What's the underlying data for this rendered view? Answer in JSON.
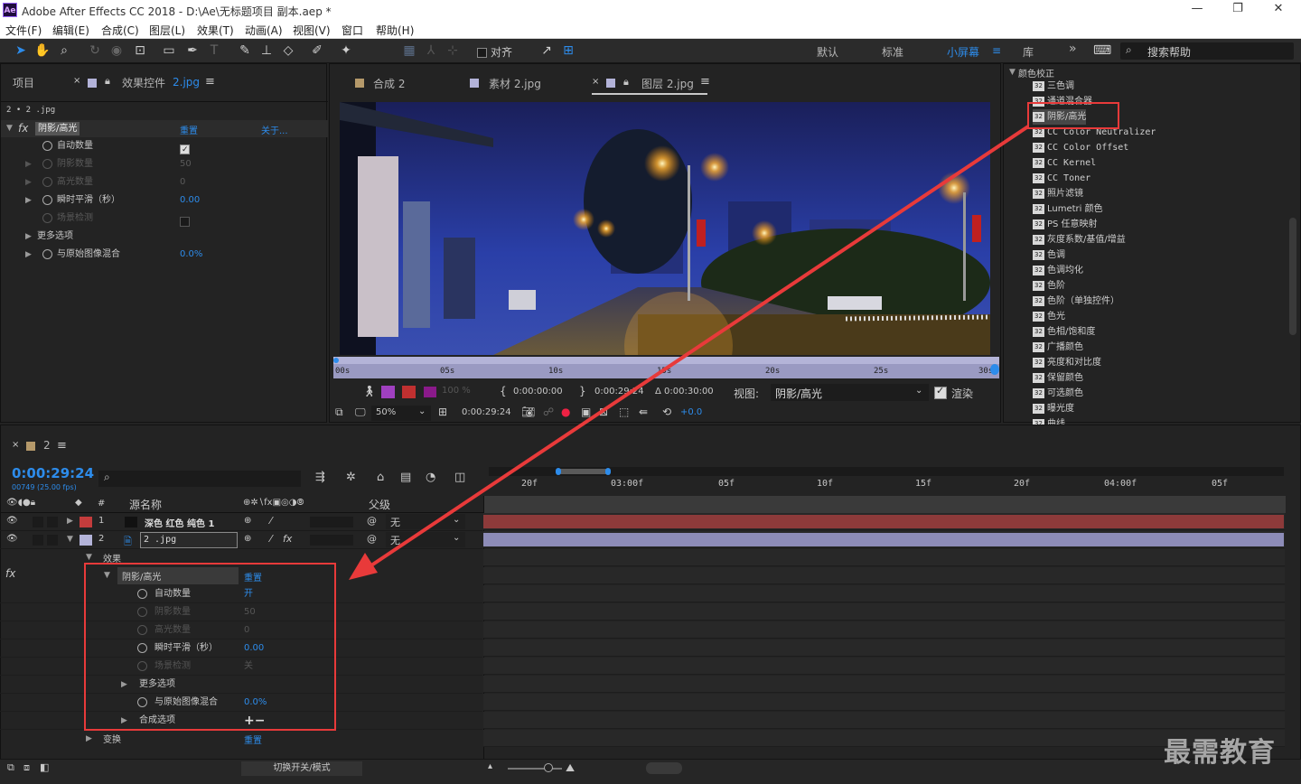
{
  "titlebar": {
    "logo": "Ae",
    "title": "Adobe After Effects CC 2018 - D:\\Ae\\无标题项目 副本.aep *",
    "min": "—",
    "restore": "❐",
    "close": "✕"
  },
  "menu": [
    "文件(F)",
    "编辑(E)",
    "合成(C)",
    "图层(L)",
    "效果(T)",
    "动画(A)",
    "视图(V)",
    "窗口",
    "帮助(H)"
  ],
  "toolbar": {
    "snap_label": "对齐",
    "workspaces": [
      "默认",
      "标准",
      "小屏幕",
      "库"
    ],
    "active_workspace": "小屏幕",
    "more": "»",
    "search_placeholder": "搜索帮助"
  },
  "left_panel": {
    "tab_project": "项目",
    "tab_effects": "效果控件",
    "tab_effects_file": "2.jpg",
    "breadcrumb": "2 • 2 .jpg",
    "effect_name": "阴影/高光",
    "reset": "重置",
    "about": "关于...",
    "props": [
      {
        "label": "自动数量",
        "value": "",
        "enabled": true
      },
      {
        "label": "阴影数量",
        "value": "50",
        "enabled": false
      },
      {
        "label": "高光数量",
        "value": "0",
        "enabled": false
      },
      {
        "label": "瞬时平滑（秒）",
        "value": "0.00",
        "enabled": true
      },
      {
        "label": "场景检测",
        "value": "",
        "enabled": false
      },
      {
        "label": "更多选项",
        "value": "",
        "enabled": true
      },
      {
        "label": "与原始图像混合",
        "value": "0.0%",
        "enabled": true
      }
    ]
  },
  "viewer": {
    "tabs": [
      {
        "label": "合成 2",
        "color": "#b5996a"
      },
      {
        "label": "素材 2.jpg",
        "color": "#b3b3d9"
      },
      {
        "label": "图层 2.jpg",
        "color": "#b3b3d9"
      }
    ],
    "ruler": [
      "00s",
      "05s",
      "10s",
      "15s",
      "20s",
      "25s",
      "30s"
    ],
    "opacity": "100 %",
    "in_time": "0:00:00:00",
    "out_time": "0:00:29:24",
    "duration": "Δ 0:00:30:00",
    "view_label": "视图:",
    "view_value": "阴影/高光",
    "render_label": "渲染",
    "zoom": "50%",
    "current_time": "0:00:29:24",
    "exposure": "+0.0"
  },
  "effects_panel": {
    "category": "颜色校正",
    "items": [
      "三色调",
      "通道混合器",
      "阴影/高光",
      "CC Color Neutralizer",
      "CC Color Offset",
      "CC Kernel",
      "CC Toner",
      "照片滤镜",
      "Lumetri 颜色",
      "PS 任意映射",
      "灰度系数/基值/增益",
      "色调",
      "色调均化",
      "色阶",
      "色阶（单独控件）",
      "色光",
      "色相/饱和度",
      "广播颜色",
      "亮度和对比度",
      "保留颜色",
      "可选颜色",
      "曝光度",
      "曲线"
    ],
    "selected": "阴影/高光"
  },
  "timeline": {
    "tab": "2",
    "time": "0:00:29:24",
    "fps": "00749 (25.00 fps)",
    "col_source": "源名称",
    "col_parent": "父级",
    "ruler": [
      "20f",
      "03:00f",
      "05f",
      "10f",
      "15f",
      "20f",
      "04:00f",
      "05f"
    ],
    "layers": [
      {
        "num": "1",
        "name": "深色 红色 纯色 1",
        "parent": "无",
        "label_color": "#c43c3c"
      },
      {
        "num": "2",
        "name": "2 .jpg",
        "parent": "无",
        "label_color": "#b3b3d9"
      }
    ],
    "effects_group": "效果",
    "fx_label": "fx",
    "effect_name": "阴影/高光",
    "reset": "重置",
    "props": [
      {
        "label": "自动数量",
        "value": "开",
        "enabled": true
      },
      {
        "label": "阴影数量",
        "value": "50",
        "enabled": false
      },
      {
        "label": "高光数量",
        "value": "0",
        "enabled": false
      },
      {
        "label": "瞬时平滑（秒）",
        "value": "0.00",
        "enabled": true
      },
      {
        "label": "场景检测",
        "value": "关",
        "enabled": false
      },
      {
        "label": "更多选项",
        "value": "",
        "enabled": true
      },
      {
        "label": "与原始图像混合",
        "value": "0.0%",
        "enabled": true
      },
      {
        "label": "合成选项",
        "value": "+−",
        "enabled": true
      }
    ],
    "transform": "变换",
    "transform_reset": "重置",
    "footer_toggle": "切换开关/模式"
  },
  "watermark": "最需教育",
  "colors": {
    "accent": "#2d8ceb",
    "highlight_box": "#e83a3a",
    "track1": "#8d3a3a",
    "track2": "#8d8cb8"
  }
}
